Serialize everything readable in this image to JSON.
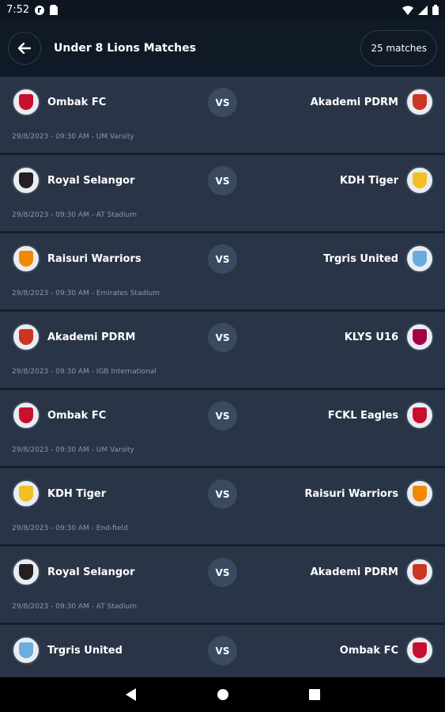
{
  "status_bar": {
    "time": "7:52"
  },
  "header": {
    "title": "Under 8 Lions Matches",
    "match_count": "25 matches"
  },
  "vs_label": "VS",
  "matches": [
    {
      "home": "Ombak FC",
      "home_crest": "liverpool-crest",
      "away": "Akademi PDRM",
      "away_crest": "atletico-crest",
      "info": "29/8/2023 - 09:30 AM - UM Varsity"
    },
    {
      "home": "Royal Selangor",
      "home_crest": "newcastle-crest",
      "away": "KDH Tiger",
      "away_crest": "real-madrid-crest",
      "info": "29/8/2023 - 09:30 AM - AT Stadium"
    },
    {
      "home": "Raisuri Warriors",
      "home_crest": "valencia-crest",
      "away": "Trgris United",
      "away_crest": "man-city-crest",
      "info": "29/8/2023 - 09:30 AM - Emirates Stadium"
    },
    {
      "home": "Akademi PDRM",
      "home_crest": "atletico-crest",
      "away": "KLYS U16",
      "away_crest": "barcelona-crest",
      "info": "29/8/2023 - 09:30 AM - IGB International"
    },
    {
      "home": "Ombak FC",
      "home_crest": "liverpool-crest",
      "away": "FCKL Eagles",
      "away_crest": "liverpool-crest",
      "info": "29/8/2023 - 09:30 AM - UM Varsity"
    },
    {
      "home": "KDH Tiger",
      "home_crest": "real-madrid-crest",
      "away": "Raisuri Warriors",
      "away_crest": "valencia-crest",
      "info": "29/8/2023 - 09:30 AM - End-field"
    },
    {
      "home": "Royal Selangor",
      "home_crest": "newcastle-crest",
      "away": "Akademi PDRM",
      "away_crest": "atletico-crest",
      "info": "29/8/2023 - 09:30 AM - AT Stadium"
    },
    {
      "home": "Trgris United",
      "home_crest": "man-city-crest",
      "away": "Ombak FC",
      "away_crest": "liverpool-crest",
      "info": ""
    }
  ],
  "colors": {
    "background": "#15202d",
    "card": "#293546",
    "header": "#0f1a26",
    "vs_badge": "#3a4b60",
    "muted_text": "#8b97a6"
  }
}
